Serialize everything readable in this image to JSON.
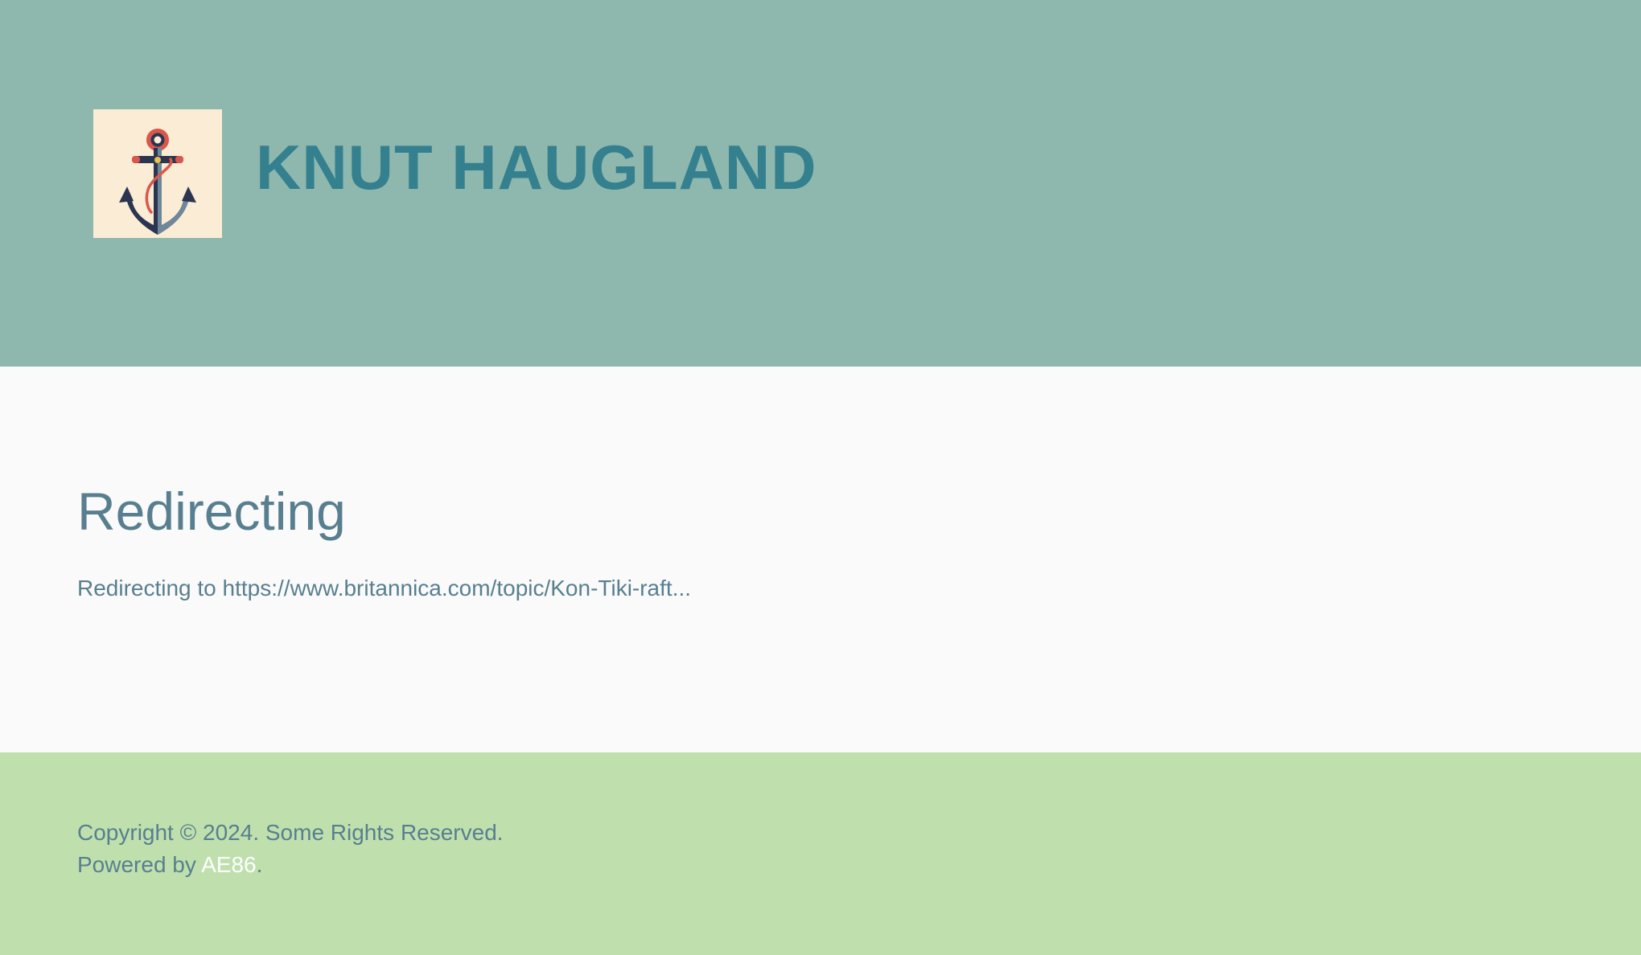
{
  "header": {
    "logo_icon": "anchor-icon",
    "site_title": "KNUT HAUGLAND",
    "background_color": "#8eb8ae",
    "title_color": "#35808f"
  },
  "main": {
    "heading": "Redirecting",
    "redirect_message": "Redirecting to https://www.britannica.com/topic/Kon-Tiki-raft...",
    "background_color": "#fafafa",
    "text_color": "#587f8f"
  },
  "footer": {
    "copyright": "Copyright © 2024. Some Rights Reserved.",
    "powered_prefix": "Powered by ",
    "powered_link": "AE86",
    "powered_suffix": ".",
    "background_color": "#bfe0ad",
    "link_color": "#ffffff"
  }
}
